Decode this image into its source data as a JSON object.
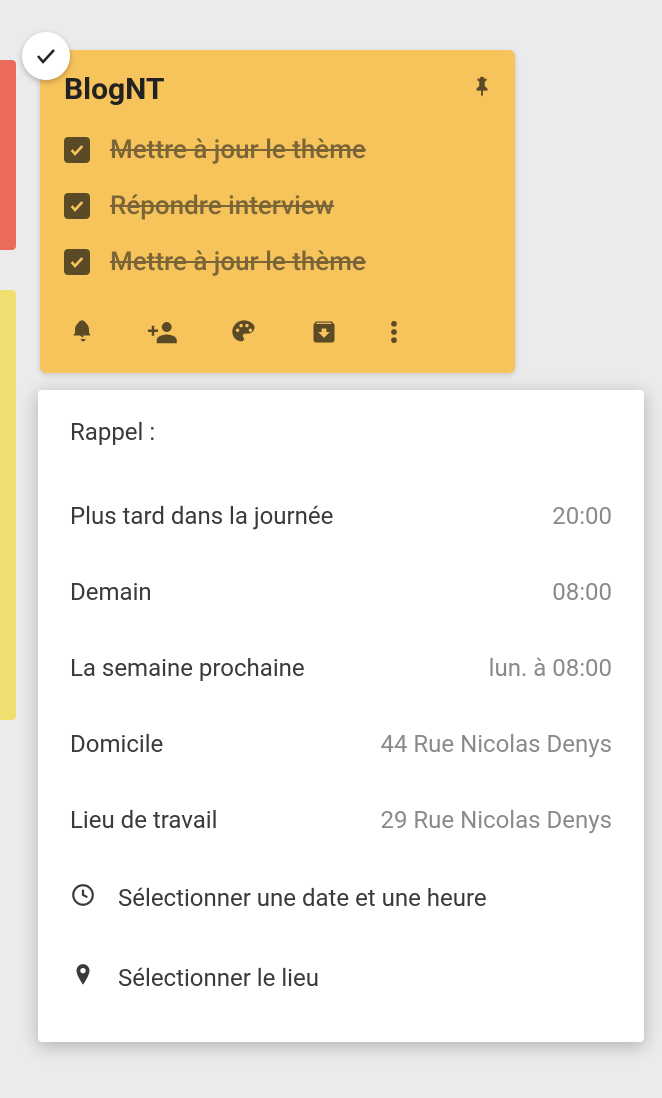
{
  "note": {
    "title": "BlogNT",
    "items": [
      {
        "label": "Mettre à jour le thème",
        "checked": true
      },
      {
        "label": "Répondre interview",
        "checked": true
      },
      {
        "label": "Mettre à jour le thème",
        "checked": true
      }
    ]
  },
  "reminder": {
    "header": "Rappel :",
    "options": [
      {
        "label": "Plus tard dans la journée",
        "value": "20:00"
      },
      {
        "label": "Demain",
        "value": "08:00"
      },
      {
        "label": "La semaine prochaine",
        "value": "lun. à 08:00"
      },
      {
        "label": "Domicile",
        "value": "44 Rue Nicolas Denys"
      },
      {
        "label": "Lieu de travail",
        "value": "29 Rue Nicolas Denys"
      }
    ],
    "actions": {
      "pick_datetime": "Sélectionner une date et une heure",
      "pick_place": "Sélectionner le lieu"
    }
  }
}
